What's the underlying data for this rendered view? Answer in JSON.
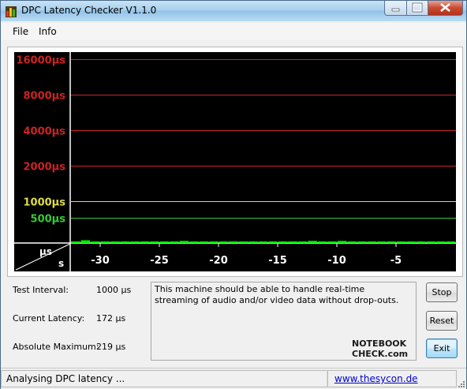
{
  "window": {
    "title": "DPC Latency Checker V1.1.0"
  },
  "menu": {
    "items": [
      "File",
      "Info"
    ]
  },
  "chart_data": {
    "type": "bar",
    "background": "#000000",
    "thresholds": [
      {
        "label": "16000µs",
        "value": 16000,
        "color": "#cc2222"
      },
      {
        "label": "8000µs",
        "value": 8000,
        "color": "#cc2222"
      },
      {
        "label": "4000µs",
        "value": 4000,
        "color": "#cc2222"
      },
      {
        "label": "2000µs",
        "value": 2000,
        "color": "#cc2222"
      },
      {
        "label": "1000µs",
        "value": 1000,
        "color": "#dddd44"
      },
      {
        "label": "500µs",
        "value": 500,
        "color": "#33cc33"
      }
    ],
    "corner_labels": {
      "y_unit": "µs",
      "x_unit": "s"
    },
    "x_ticks": [
      "-30",
      "-25",
      "-20",
      "-15",
      "-10",
      "-5"
    ],
    "series": [
      {
        "color": "#00ee00",
        "values": [
          175,
          195,
          185,
          160,
          180,
          170,
          175,
          170,
          175,
          165,
          180,
          190,
          170,
          175,
          170,
          175,
          170,
          175,
          165,
          170,
          175,
          180,
          170,
          185,
          190,
          175,
          170,
          190,
          180,
          175,
          165,
          170,
          175,
          165,
          180,
          170,
          172,
          168,
          170
        ]
      }
    ]
  },
  "stats": {
    "test_interval": {
      "label": "Test Interval:",
      "value": "1000 µs"
    },
    "current_latency": {
      "label": "Current Latency:",
      "value": "172 µs"
    },
    "absolute_maximum": {
      "label": "Absolute Maximum:",
      "value": "219 µs"
    }
  },
  "message": "This machine should be able to handle real-time streaming of audio and/or video data without drop-outs.",
  "logo": {
    "line1": "NOTEBOOK",
    "line2": "CHECK.com"
  },
  "buttons": {
    "stop": "Stop",
    "reset": "Reset",
    "exit": "Exit"
  },
  "status": {
    "text": "Analysing DPC latency ...",
    "link": "www.thesycon.de"
  }
}
